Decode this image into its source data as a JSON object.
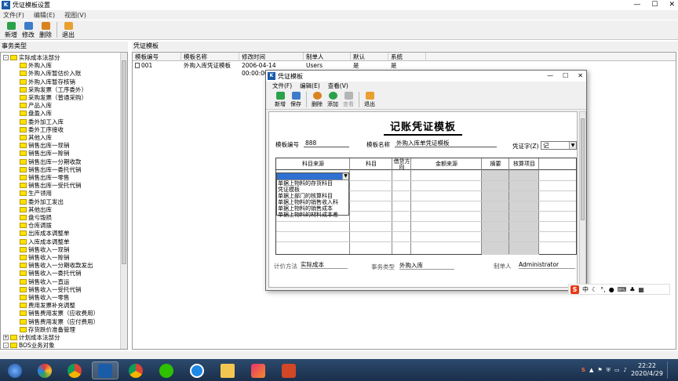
{
  "main_window": {
    "title": "凭证模板设置",
    "menu": [
      "文件(F)",
      "编辑(E)",
      "视图(V)"
    ],
    "toolbar": [
      {
        "label": "新增",
        "icon": "new-icon",
        "color": "#2aa14a"
      },
      {
        "label": "修改",
        "icon": "edit-icon",
        "color": "#3d7cc9"
      },
      {
        "label": "删除",
        "icon": "delete-icon",
        "color": "#d9831f"
      },
      {
        "label": "退出",
        "icon": "exit-icon",
        "color": "#e8a030"
      }
    ]
  },
  "left_panel": {
    "header": "事务类型",
    "tree": [
      {
        "label": "实际成本法部分",
        "level": 0,
        "expander": "-"
      },
      {
        "label": "外购入库",
        "level": 1
      },
      {
        "label": "外购入库暂估价入账",
        "level": 1
      },
      {
        "label": "外购入库暂存核销",
        "level": 1
      },
      {
        "label": "采购发票（工序委外）",
        "level": 1
      },
      {
        "label": "采购发票（普通采购）",
        "level": 1
      },
      {
        "label": "产品入库",
        "level": 1
      },
      {
        "label": "盘盈入库",
        "level": 1
      },
      {
        "label": "委外加工入库",
        "level": 1
      },
      {
        "label": "委外工序接收",
        "level": 1
      },
      {
        "label": "其他入库",
        "level": 1
      },
      {
        "label": "销售出库一现销",
        "level": 1
      },
      {
        "label": "销售出库一赊销",
        "level": 1
      },
      {
        "label": "销售出库一分期收款",
        "level": 1
      },
      {
        "label": "销售出库一委托代销",
        "level": 1
      },
      {
        "label": "销售出库一零售",
        "level": 1
      },
      {
        "label": "销售出库一受托代销",
        "level": 1
      },
      {
        "label": "生产领用",
        "level": 1
      },
      {
        "label": "委外加工发出",
        "level": 1
      },
      {
        "label": "其他出库",
        "level": 1
      },
      {
        "label": "盘亏毁损",
        "level": 1
      },
      {
        "label": "仓库调拨",
        "level": 1
      },
      {
        "label": "出库成本调整单",
        "level": 1
      },
      {
        "label": "入库成本调整单",
        "level": 1
      },
      {
        "label": "销售收入一现销",
        "level": 1
      },
      {
        "label": "销售收入一赊销",
        "level": 1
      },
      {
        "label": "销售收入一分期收款发出",
        "level": 1
      },
      {
        "label": "销售收入一委托代销",
        "level": 1
      },
      {
        "label": "销售收入一直运",
        "level": 1
      },
      {
        "label": "销售收入一受托代销",
        "level": 1
      },
      {
        "label": "销售收入一零售",
        "level": 1
      },
      {
        "label": "费用发票补充调整",
        "level": 1
      },
      {
        "label": "销售费用发票（应收费用）",
        "level": 1
      },
      {
        "label": "销售费用发票（应付费用）",
        "level": 1
      },
      {
        "label": "存货跌价准备管理",
        "level": 1
      },
      {
        "label": "计划成本法部分",
        "level": 0,
        "expander": "+"
      },
      {
        "label": "BOS业务对象",
        "level": 0,
        "expander": "-"
      }
    ]
  },
  "right_panel": {
    "header": "凭证模板",
    "columns": [
      "模板编号",
      "模板名称",
      "修改时间",
      "制单人",
      "默认",
      "系统"
    ],
    "rows": [
      {
        "cells": [
          "001",
          "外购入库凭证模板",
          "2006-04-14 00:00:00",
          "Users",
          "是",
          "是"
        ]
      }
    ]
  },
  "dialog": {
    "title": "凭证模板",
    "menu": [
      "文件(F)",
      "编辑(E)",
      "查看(V)"
    ],
    "toolbar": [
      {
        "label": "新增",
        "icon": "new-icon",
        "color": "#2aa14a"
      },
      {
        "label": "保存",
        "icon": "save-icon",
        "color": "#3d7cc9"
      },
      {
        "label": "删除",
        "icon": "delete-icon",
        "color": "#d9831f"
      },
      {
        "label": "添加",
        "icon": "add-icon",
        "color": "#2aa14a"
      },
      {
        "label": "查看",
        "icon": "view-icon",
        "color": "#9a9a9a"
      },
      {
        "label": "退出",
        "icon": "exit-icon",
        "color": "#e8a030"
      }
    ],
    "doc_title": "记账凭证模板",
    "template_no_label": "模板编号",
    "template_no": "888",
    "template_name_label": "模板名称",
    "template_name": "外购入库单凭证模板",
    "voucher_word_label": "凭证字(Z)",
    "voucher_word": "记",
    "table_headers": [
      "科目来源",
      "科目",
      "借贷方向",
      "金额来源",
      "摘要",
      "核算项目"
    ],
    "dropdown_options": [
      "单据上物料的存货科目",
      "凭证模板",
      "单据上部门的核算科目",
      "单据上物料的销售收入科",
      "单据上物料的销售成本",
      "单据上物料的材料成本差"
    ],
    "footer": {
      "calc_method_label": "计价方法",
      "calc_method": "实际成本",
      "biz_type_label": "事务类型",
      "biz_type": "外购入库",
      "maker_label": "制单人",
      "maker": "Administrator"
    }
  },
  "ime_bar": {
    "logo": "S",
    "lang": "中"
  },
  "taskbar": {
    "time": "22:22",
    "date": "2020/4/29"
  }
}
